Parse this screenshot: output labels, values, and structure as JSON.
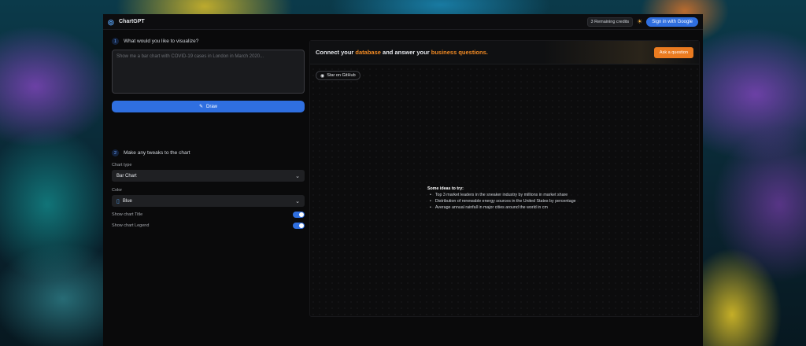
{
  "header": {
    "brand": "ChartGPT",
    "brand_icon": "chart-logo-icon",
    "credits": "3 Remaining credits",
    "theme_icon": "sun-icon",
    "signin": "Sign in with Google"
  },
  "visualize": {
    "step": "1",
    "title": "What would you like to visualize?",
    "placeholder": "Show me a bar chart with COVID-19 cases in London in March 2020...",
    "value": "",
    "draw_label": "Draw"
  },
  "tweaks": {
    "step": "2",
    "title": "Make any tweaks to the chart",
    "chart_type_label": "Chart type",
    "chart_type_value": "Bar Chart",
    "color_label": "Color",
    "color_value": "Blue",
    "show_title_label": "Show chart Title",
    "show_title_on": true,
    "show_legend_label": "Show chart Legend",
    "show_legend_on": true
  },
  "banner": {
    "text_1": "Connect your ",
    "highlight_1": "database",
    "text_2": " and answer your ",
    "highlight_2": "business questions.",
    "ask_label": "Ask a question"
  },
  "github": {
    "label": "Star on GitHub"
  },
  "ideas": {
    "title": "Some ideas to try:",
    "items": [
      "Top 3 market leaders in the sneaker industry by millions in market share",
      "Distribution of renewable energy sources in the United States by percentage",
      "Average annual rainfall in major cities around the world in cm"
    ]
  },
  "colors": {
    "accent": "#2f6fe0",
    "orange": "#f08a24",
    "background": "#0a0a0b"
  }
}
